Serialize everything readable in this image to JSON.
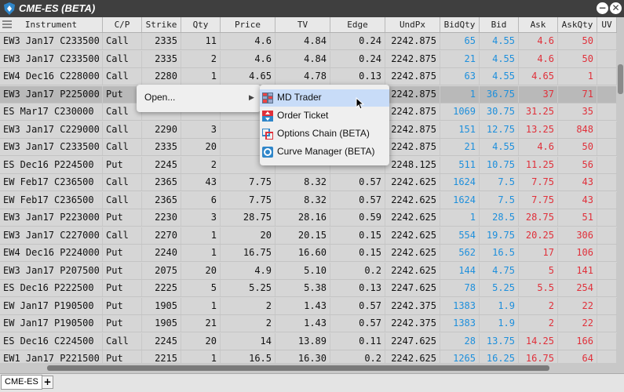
{
  "window": {
    "title": "CME-ES (BETA)"
  },
  "columns": [
    "Instrument",
    "C/P",
    "Strike",
    "Qty",
    "Price",
    "TV",
    "Edge",
    "UndPx",
    "BidQty",
    "Bid",
    "Ask",
    "AskQty",
    "UV"
  ],
  "rows": [
    [
      "EW3 Jan17 C233500",
      "Call",
      "2335",
      "11",
      "4.6",
      "4.84",
      "0.24",
      "2242.875",
      "65",
      "4.55",
      "4.6",
      "50"
    ],
    [
      "EW3 Jan17 C233500",
      "Call",
      "2335",
      "2",
      "4.6",
      "4.84",
      "0.24",
      "2242.875",
      "21",
      "4.55",
      "4.6",
      "50"
    ],
    [
      "EW4 Dec16 C228000",
      "Call",
      "2280",
      "1",
      "4.65",
      "4.78",
      "0.13",
      "2242.875",
      "63",
      "4.55",
      "4.65",
      "1"
    ],
    [
      "EW3 Jan17 P225000",
      "Put",
      "",
      "",
      "",
      "",
      "",
      "2242.875",
      "1",
      "36.75",
      "37",
      "71"
    ],
    [
      "ES Mar17 C230000",
      "Call",
      "",
      "",
      "",
      "",
      "",
      "2242.875",
      "1069",
      "30.75",
      "31.25",
      "35"
    ],
    [
      "EW3 Jan17 C229000",
      "Call",
      "2290",
      "3",
      "",
      "",
      "",
      "2242.875",
      "151",
      "12.75",
      "13.25",
      "848"
    ],
    [
      "EW3 Jan17 C233500",
      "Call",
      "2335",
      "20",
      "4",
      "",
      "",
      "2242.875",
      "21",
      "4.55",
      "4.6",
      "50"
    ],
    [
      "ES Dec16 P224500",
      "Put",
      "2245",
      "2",
      "",
      "",
      "",
      "2248.125",
      "511",
      "10.75",
      "11.25",
      "56"
    ],
    [
      "EW Feb17 C236500",
      "Call",
      "2365",
      "43",
      "7.75",
      "8.32",
      "0.57",
      "2242.625",
      "1624",
      "7.5",
      "7.75",
      "43"
    ],
    [
      "EW Feb17 C236500",
      "Call",
      "2365",
      "6",
      "7.75",
      "8.32",
      "0.57",
      "2242.625",
      "1624",
      "7.5",
      "7.75",
      "43"
    ],
    [
      "EW3 Jan17 P223000",
      "Put",
      "2230",
      "3",
      "28.75",
      "28.16",
      "0.59",
      "2242.625",
      "1",
      "28.5",
      "28.75",
      "51"
    ],
    [
      "EW3 Jan17 C227000",
      "Call",
      "2270",
      "1",
      "20",
      "20.15",
      "0.15",
      "2242.625",
      "554",
      "19.75",
      "20.25",
      "306"
    ],
    [
      "EW4 Dec16 P224000",
      "Put",
      "2240",
      "1",
      "16.75",
      "16.60",
      "0.15",
      "2242.625",
      "562",
      "16.5",
      "17",
      "106"
    ],
    [
      "EW3 Jan17 P207500",
      "Put",
      "2075",
      "20",
      "4.9",
      "5.10",
      "0.2",
      "2242.625",
      "144",
      "4.75",
      "5",
      "141"
    ],
    [
      "ES Dec16 P222500",
      "Put",
      "2225",
      "5",
      "5.25",
      "5.38",
      "0.13",
      "2247.625",
      "78",
      "5.25",
      "5.5",
      "254"
    ],
    [
      "EW Jan17 P190500",
      "Put",
      "1905",
      "1",
      "2",
      "1.43",
      "0.57",
      "2242.375",
      "1383",
      "1.9",
      "2",
      "22"
    ],
    [
      "EW Jan17 P190500",
      "Put",
      "1905",
      "21",
      "2",
      "1.43",
      "0.57",
      "2242.375",
      "1383",
      "1.9",
      "2",
      "22"
    ],
    [
      "ES Dec16 C224500",
      "Call",
      "2245",
      "20",
      "14",
      "13.89",
      "0.11",
      "2247.625",
      "28",
      "13.75",
      "14.25",
      "166"
    ],
    [
      "EW1 Jan17 P221500",
      "Put",
      "2215",
      "1",
      "16.5",
      "16.30",
      "0.2",
      "2242.625",
      "1265",
      "16.25",
      "16.75",
      "64"
    ]
  ],
  "context_menu": {
    "open_label": "Open...",
    "arrow": "▶"
  },
  "submenu": {
    "items": [
      {
        "label": "MD Trader",
        "icon": "md-trader-icon"
      },
      {
        "label": "Order Ticket",
        "icon": "order-ticket-icon"
      },
      {
        "label": "Options Chain (BETA)",
        "icon": "options-chain-icon"
      },
      {
        "label": "Curve Manager (BETA)",
        "icon": "curve-manager-icon"
      }
    ]
  },
  "tabs": [
    {
      "label": "CME-ES"
    }
  ],
  "add_tab_label": "+",
  "controls": {
    "minimize": "−",
    "close": "✕"
  },
  "colors": {
    "bid": "#1d8fdc",
    "ask": "#e0303a",
    "titlebar": "#3f3f3f"
  }
}
